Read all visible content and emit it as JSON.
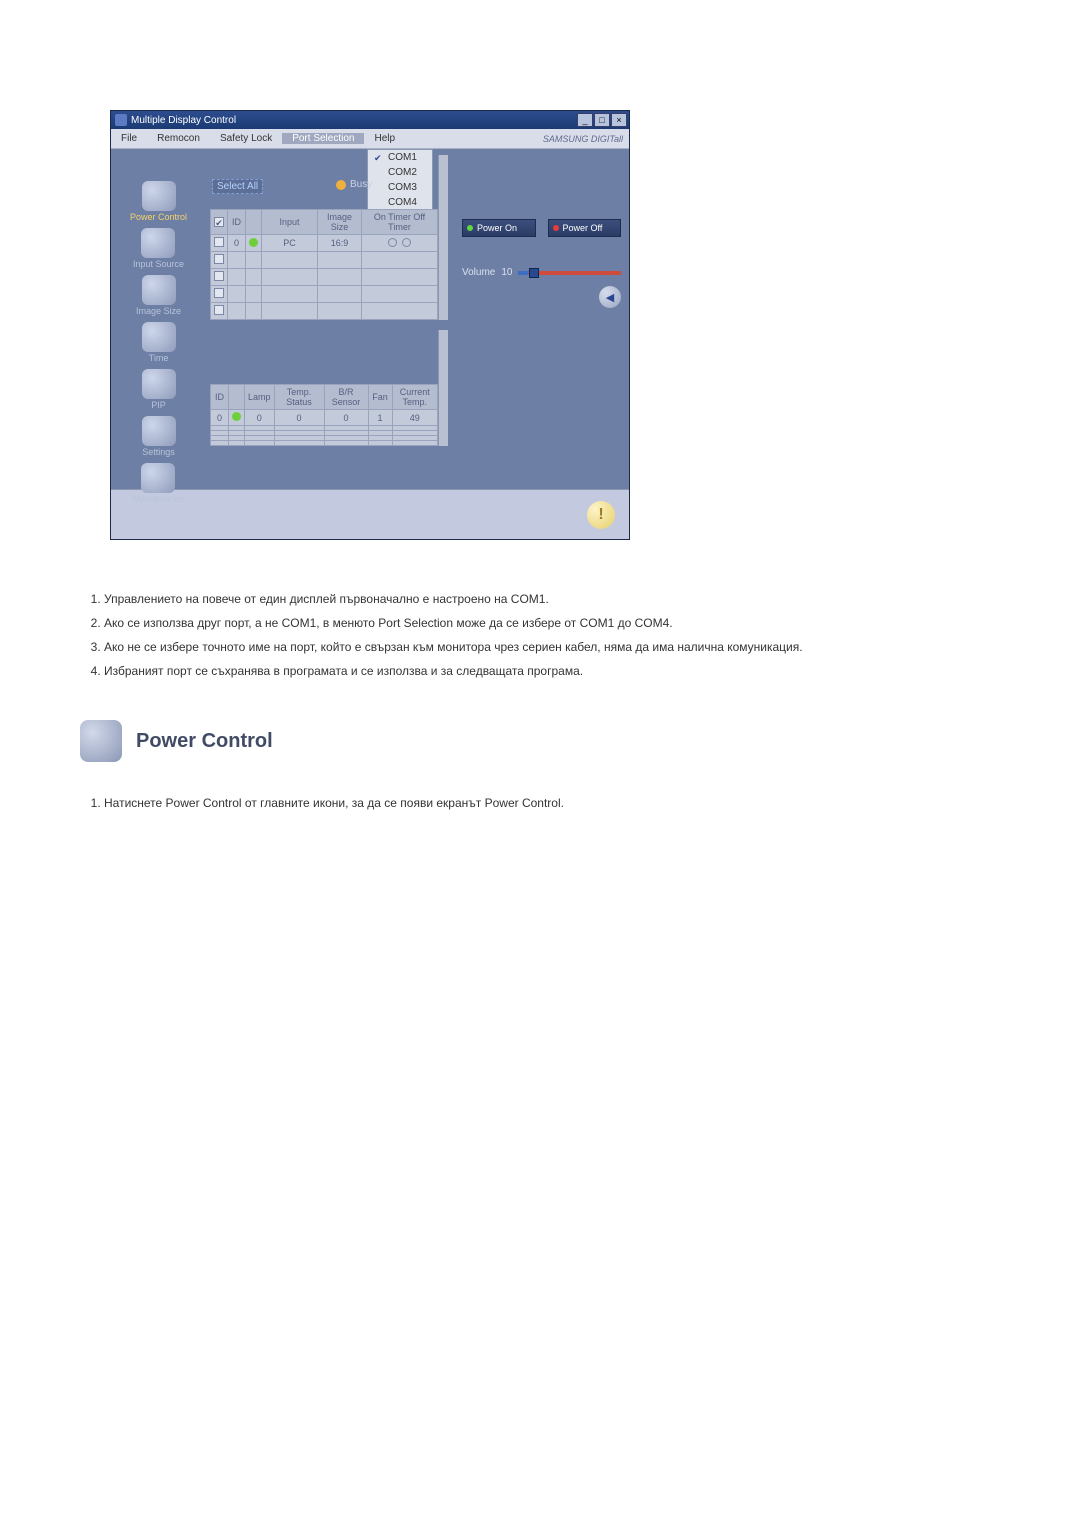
{
  "window": {
    "title": "Multiple Display Control",
    "menu": {
      "file": "File",
      "remocon": "Remocon",
      "safety": "Safety Lock",
      "port": "Port Selection",
      "help": "Help"
    },
    "brand": "SAMSUNG DIGITall",
    "port_options": [
      "COM1",
      "COM2",
      "COM3",
      "COM4"
    ],
    "select_all": "Select All",
    "busy": "Busy"
  },
  "nav": {
    "power": "Power Control",
    "input": "Input Source",
    "image": "Image Size",
    "time": "Time",
    "pip": "PIP",
    "settings": "Settings",
    "maint": "Maintenance"
  },
  "top_table": {
    "headers": {
      "id": "ID",
      "sig": "",
      "input": "Input",
      "imgsize": "Image Size",
      "timer": "On Timer Off Timer"
    },
    "row": {
      "id": "0",
      "input": "PC",
      "imgsize": "16:9",
      "timer1": "O",
      "timer2": "O"
    }
  },
  "bottom_table": {
    "headers": {
      "id": "ID",
      "sig": "",
      "lamp": "Lamp",
      "temp": "Temp. Status",
      "bvr": "B/R Sensor",
      "fan": "Fan",
      "cur": "Current Temp."
    },
    "row": {
      "id": "0",
      "lamp": "0",
      "temp": "0",
      "bvr": "0",
      "fan": "1",
      "cur": "49"
    }
  },
  "panel": {
    "power_on": "Power On",
    "power_off": "Power Off",
    "volume_label": "Volume",
    "volume_value": "10"
  },
  "doc": {
    "list": [
      "Управлението на повече от един дисплей първоначално е настроено на COM1.",
      "Ако се използва друг порт, а не COM1, в менюто Port Selection може да се избере от COM1 до COM4.",
      "Ако не се избере точното име на порт, който е свързан към монитора чрез сериен кабел, няма да има налична комуникация.",
      "Избраният порт се съхранява в програмата и се използва и за следващата програма."
    ],
    "heading": "Power Control",
    "instr": "Натиснете Power Control от главните икони, за да се появи екранът Power Control."
  }
}
